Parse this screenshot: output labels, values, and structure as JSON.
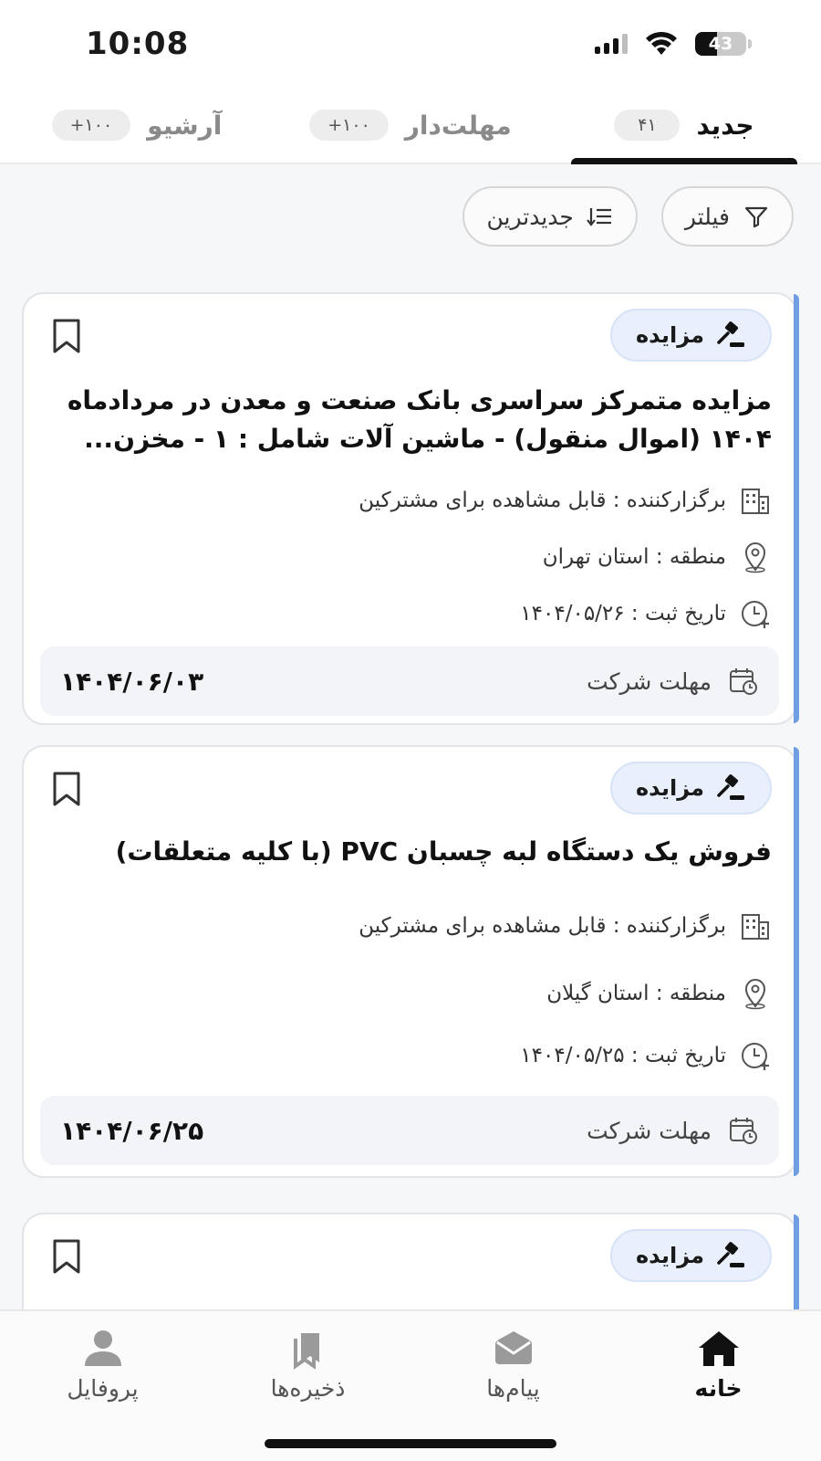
{
  "status": {
    "time": "10:08",
    "battery": "43",
    "battery_level": 0.43
  },
  "tabs": [
    {
      "label": "جدید",
      "badge": "۴۱",
      "active": true
    },
    {
      "label": "مهلت‌دار",
      "badge": "۱۰۰+",
      "active": false
    },
    {
      "label": "آرشیو",
      "badge": "۱۰۰+",
      "active": false
    }
  ],
  "filters": {
    "filter_label": "فیلتر",
    "sort_label": "جدیدترین"
  },
  "cards": [
    {
      "type": "مزایده",
      "title": "مزایده متمرکز سراسری بانک صنعت و معدن در مردادماه ۱۴۰۴ (اموال منقول) - ماشین آلات شامل : ۱ - مخزن...",
      "organizer": "برگزارکننده : قابل مشاهده برای مشترکین",
      "region": "منطقه : استان تهران",
      "registered": "تاریخ ثبت : ۱۴۰۴/۰۵/۲۶",
      "deadline_label": "مهلت شرکت",
      "deadline_date": "۱۴۰۴/۰۶/۰۳"
    },
    {
      "type": "مزایده",
      "title": "فروش یک دستگاه لبه چسبان PVC (با کلیه متعلقات)",
      "organizer": "برگزارکننده : قابل مشاهده برای مشترکین",
      "region": "منطقه : استان گیلان",
      "registered": "تاریخ ثبت : ۱۴۰۴/۰۵/۲۵",
      "deadline_label": "مهلت شرکت",
      "deadline_date": "۱۴۰۴/۰۶/۲۵"
    },
    {
      "type": "مزایده"
    }
  ],
  "nav": [
    {
      "label": "خانه",
      "icon": "home-icon",
      "active": true
    },
    {
      "label": "پیام‌ها",
      "icon": "messages-icon",
      "active": false
    },
    {
      "label": "ذخیره‌ها",
      "icon": "saved-icon",
      "active": false
    },
    {
      "label": "پروفایل",
      "icon": "profile-icon",
      "active": false
    }
  ]
}
